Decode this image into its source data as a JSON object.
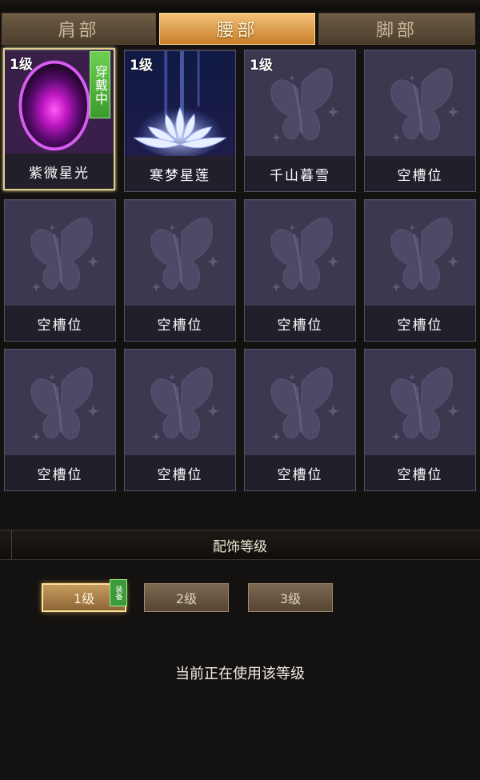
{
  "tabs": [
    {
      "label": "肩部",
      "active": false
    },
    {
      "label": "腰部",
      "active": true
    },
    {
      "label": "脚部",
      "active": false
    }
  ],
  "slots": [
    {
      "label": "紫微星光",
      "level": "1级",
      "badge": "穿戴中",
      "art": "purple-orb-icon",
      "selected": true
    },
    {
      "label": "寒梦星莲",
      "level": "1级",
      "badge": "",
      "art": "white-lotus-icon",
      "selected": false
    },
    {
      "label": "千山暮雪",
      "level": "1级",
      "badge": "",
      "art": "butterfly-icon",
      "selected": false
    },
    {
      "label": "空槽位",
      "level": "",
      "badge": "",
      "art": "butterfly-icon",
      "selected": false
    },
    {
      "label": "空槽位",
      "level": "",
      "badge": "",
      "art": "butterfly-icon",
      "selected": false
    },
    {
      "label": "空槽位",
      "level": "",
      "badge": "",
      "art": "butterfly-icon",
      "selected": false
    },
    {
      "label": "空槽位",
      "level": "",
      "badge": "",
      "art": "butterfly-icon",
      "selected": false
    },
    {
      "label": "空槽位",
      "level": "",
      "badge": "",
      "art": "butterfly-icon",
      "selected": false
    },
    {
      "label": "空槽位",
      "level": "",
      "badge": "",
      "art": "butterfly-icon",
      "selected": false
    },
    {
      "label": "空槽位",
      "level": "",
      "badge": "",
      "art": "butterfly-icon",
      "selected": false
    },
    {
      "label": "空槽位",
      "level": "",
      "badge": "",
      "art": "butterfly-icon",
      "selected": false
    },
    {
      "label": "空槽位",
      "level": "",
      "badge": "",
      "art": "butterfly-icon",
      "selected": false
    }
  ],
  "level_section": {
    "title": "配饰等级",
    "buttons": [
      {
        "label": "1级",
        "active": true
      },
      {
        "label": "2级",
        "active": false
      },
      {
        "label": "3级",
        "active": false
      }
    ],
    "equipped_tag": "装备",
    "status_text": "当前正在使用该等级"
  },
  "colors": {
    "active_tab": "#e9a24f",
    "wearing_badge": "#4cae38",
    "selected_border": "#e2cf8b"
  }
}
